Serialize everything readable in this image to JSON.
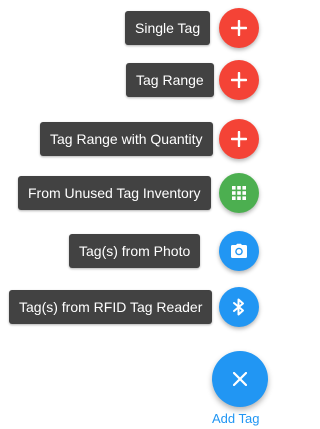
{
  "colors": {
    "red": "#f44336",
    "green": "#4caf50",
    "blue": "#2196f3",
    "label_bg": "#424242",
    "link": "#2196f3"
  },
  "menu": {
    "items": [
      {
        "label": "Single Tag",
        "icon": "plus-icon",
        "color": "#f44336"
      },
      {
        "label": "Tag Range",
        "icon": "plus-icon",
        "color": "#f44336"
      },
      {
        "label": "Tag Range with Quantity",
        "icon": "plus-icon",
        "color": "#f44336"
      },
      {
        "label": "From Unused Tag Inventory",
        "icon": "grid-icon",
        "color": "#4caf50"
      },
      {
        "label": "Tag(s) from Photo",
        "icon": "camera-icon",
        "color": "#2196f3"
      },
      {
        "label": "Tag(s) from RFID Tag Reader",
        "icon": "bluetooth-icon",
        "color": "#2196f3"
      }
    ]
  },
  "main_fab": {
    "icon": "close-icon",
    "color": "#2196f3",
    "label": "Add Tag"
  }
}
